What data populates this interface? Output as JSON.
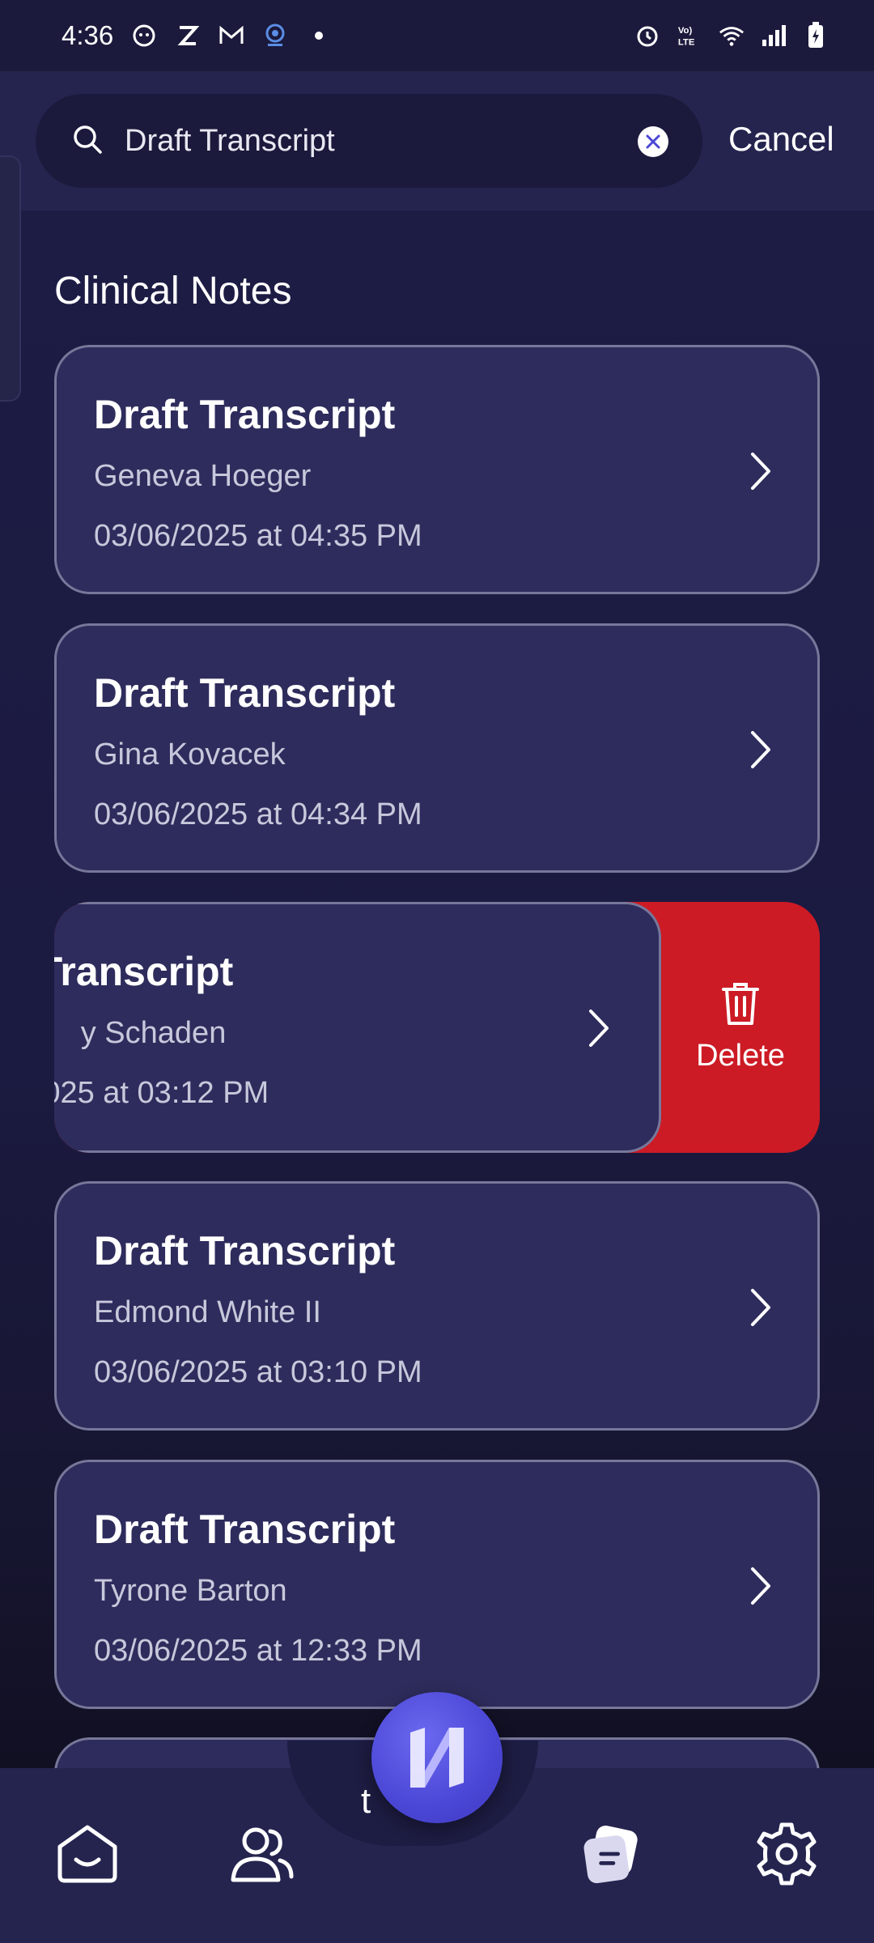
{
  "status_bar": {
    "time": "4:36",
    "left_icons": [
      "face-icon",
      "z-icon",
      "gmail-icon",
      "webcam-icon",
      "dot-icon"
    ],
    "right_icons": [
      "alarm-icon",
      "volte-icon",
      "wifi-icon",
      "signal-icon",
      "battery-charging-icon"
    ]
  },
  "search": {
    "value": "Draft Transcript",
    "cancel_label": "Cancel"
  },
  "section": {
    "title": "Clinical Notes"
  },
  "notes": [
    {
      "title": "Draft Transcript",
      "patient": "Geneva Hoeger",
      "datetime": "03/06/2025 at 04:35 PM"
    },
    {
      "title": "Draft Transcript",
      "patient": "Gina Kovacek",
      "datetime": "03/06/2025 at 04:34 PM"
    },
    {
      "title": "Transcript",
      "patient": "y Schaden",
      "datetime": "025 at 03:12 PM"
    },
    {
      "title": "Draft Transcript",
      "patient": "Edmond White II",
      "datetime": "03/06/2025 at 03:10 PM"
    },
    {
      "title": "Draft Transcript",
      "patient": "Tyrone Barton",
      "datetime": "03/06/2025 at 12:33 PM"
    }
  ],
  "swipe_action": {
    "label": "Delete",
    "color": "#cc1b25"
  },
  "bottom_nav": {
    "items": [
      "home-icon",
      "patients-icon",
      "app-logo-fab",
      "notes-icon",
      "settings-icon"
    ],
    "peek_text": "t"
  },
  "colors": {
    "background": "#1d1c45",
    "card": "#2e2c5c",
    "card_border": "#77779a",
    "accent": "#4b47d6",
    "delete": "#cc1b25"
  }
}
